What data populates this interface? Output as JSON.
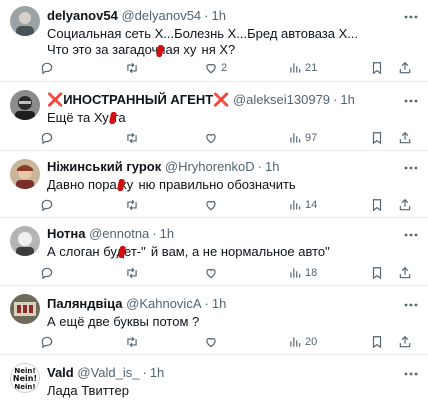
{
  "tweets": [
    {
      "name": "delyanov54",
      "handle": "@delyanov54",
      "time": "1h",
      "lines": [
        "Социальная сеть Х...Болезнь Х...Бред автоваза Х...",
        "Что это за загадочная ху  ня Х?"
      ],
      "reply_count": "",
      "retweet_count": "",
      "like_count": "2",
      "view_count": "21"
    },
    {
      "name_prefix": "❌",
      "name": "ИНОСТРАННЫЙ АГЕНТ",
      "name_suffix": "❌",
      "handle": "@aleksei130979",
      "time": "1h",
      "lines": [
        "Ещё та Ху  га"
      ],
      "reply_count": "",
      "retweet_count": "",
      "like_count": "",
      "view_count": "97"
    },
    {
      "name": "Ніжинський гурок",
      "handle": "@HryhorenkoD",
      "time": "1h",
      "lines": [
        "Давно пора ху  ню правильно обозначить"
      ],
      "reply_count": "",
      "retweet_count": "",
      "like_count": "",
      "view_count": "14"
    },
    {
      "name": "Нотна",
      "handle": "@ennotna",
      "time": "1h",
      "lines": [
        "А слоган будет-\"  й вам, а не нормальное авто\""
      ],
      "reply_count": "",
      "retweet_count": "",
      "like_count": "",
      "view_count": "18"
    },
    {
      "name": "Паляндвіца",
      "handle": "@KahnovicA",
      "time": "1h",
      "lines": [
        "А ещё две буквы потом ?"
      ],
      "reply_count": "",
      "retweet_count": "",
      "like_count": "",
      "view_count": "20"
    },
    {
      "name": "Vald",
      "handle": "@Vald_is_",
      "time": "1h",
      "lines": [
        "Лада Твиттер"
      ],
      "avatar_text": [
        "Nein!",
        "Nein!",
        "Nein!"
      ]
    }
  ],
  "colors": {
    "text": "#0f1419",
    "muted": "#536471",
    "divider": "#e6ecf0",
    "censor_mark": "#d10f0f"
  },
  "icons": [
    "reply-icon",
    "retweet-icon",
    "like-icon",
    "views-icon",
    "bookmark-icon",
    "share-icon",
    "more-icon"
  ]
}
